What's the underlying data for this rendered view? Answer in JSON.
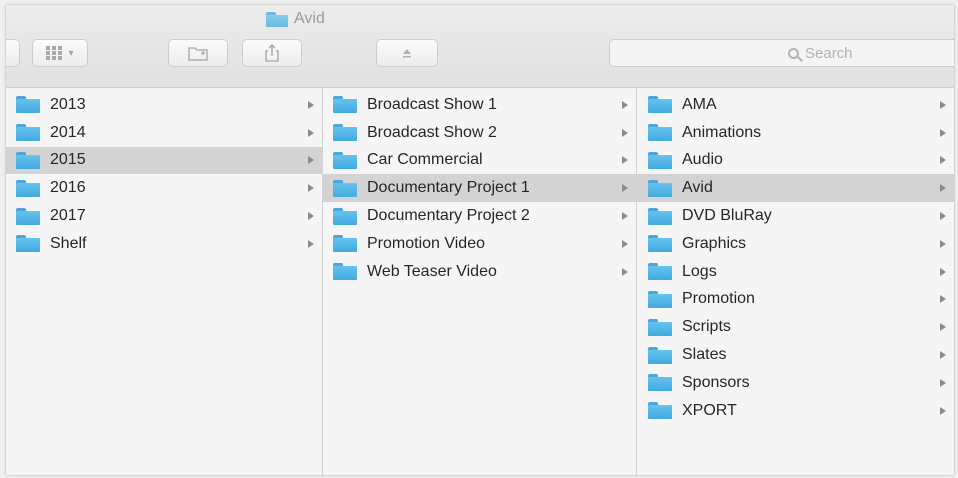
{
  "window": {
    "title": "Avid"
  },
  "toolbar": {
    "view_icon": "column-view-icon",
    "new_folder_icon": "new-folder-icon",
    "share_icon": "share-icon",
    "eject_icon": "eject-icon",
    "share_glyph": "⇧",
    "eject_glyph": "⏏"
  },
  "search": {
    "placeholder": "Search"
  },
  "columns": [
    {
      "items": [
        {
          "label": "2013"
        },
        {
          "label": "2014"
        },
        {
          "label": "2015",
          "selected": true
        },
        {
          "label": "2016"
        },
        {
          "label": "2017"
        },
        {
          "label": "Shelf"
        }
      ]
    },
    {
      "items": [
        {
          "label": "Broadcast Show 1"
        },
        {
          "label": "Broadcast Show 2"
        },
        {
          "label": "Car Commercial"
        },
        {
          "label": "Documentary Project 1",
          "selected": true
        },
        {
          "label": "Documentary Project 2"
        },
        {
          "label": "Promotion Video"
        },
        {
          "label": "Web Teaser Video"
        }
      ]
    },
    {
      "items": [
        {
          "label": "AMA"
        },
        {
          "label": "Animations"
        },
        {
          "label": "Audio"
        },
        {
          "label": "Avid",
          "selected": true
        },
        {
          "label": "DVD BluRay"
        },
        {
          "label": "Graphics"
        },
        {
          "label": "Logs"
        },
        {
          "label": "Promotion"
        },
        {
          "label": "Scripts"
        },
        {
          "label": "Slates"
        },
        {
          "label": "Sponsors"
        },
        {
          "label": "XPORT"
        }
      ]
    }
  ],
  "colors": {
    "folder": "#4aa6dc",
    "selection": "#d3d3d3",
    "background": "#f5f5f5"
  }
}
